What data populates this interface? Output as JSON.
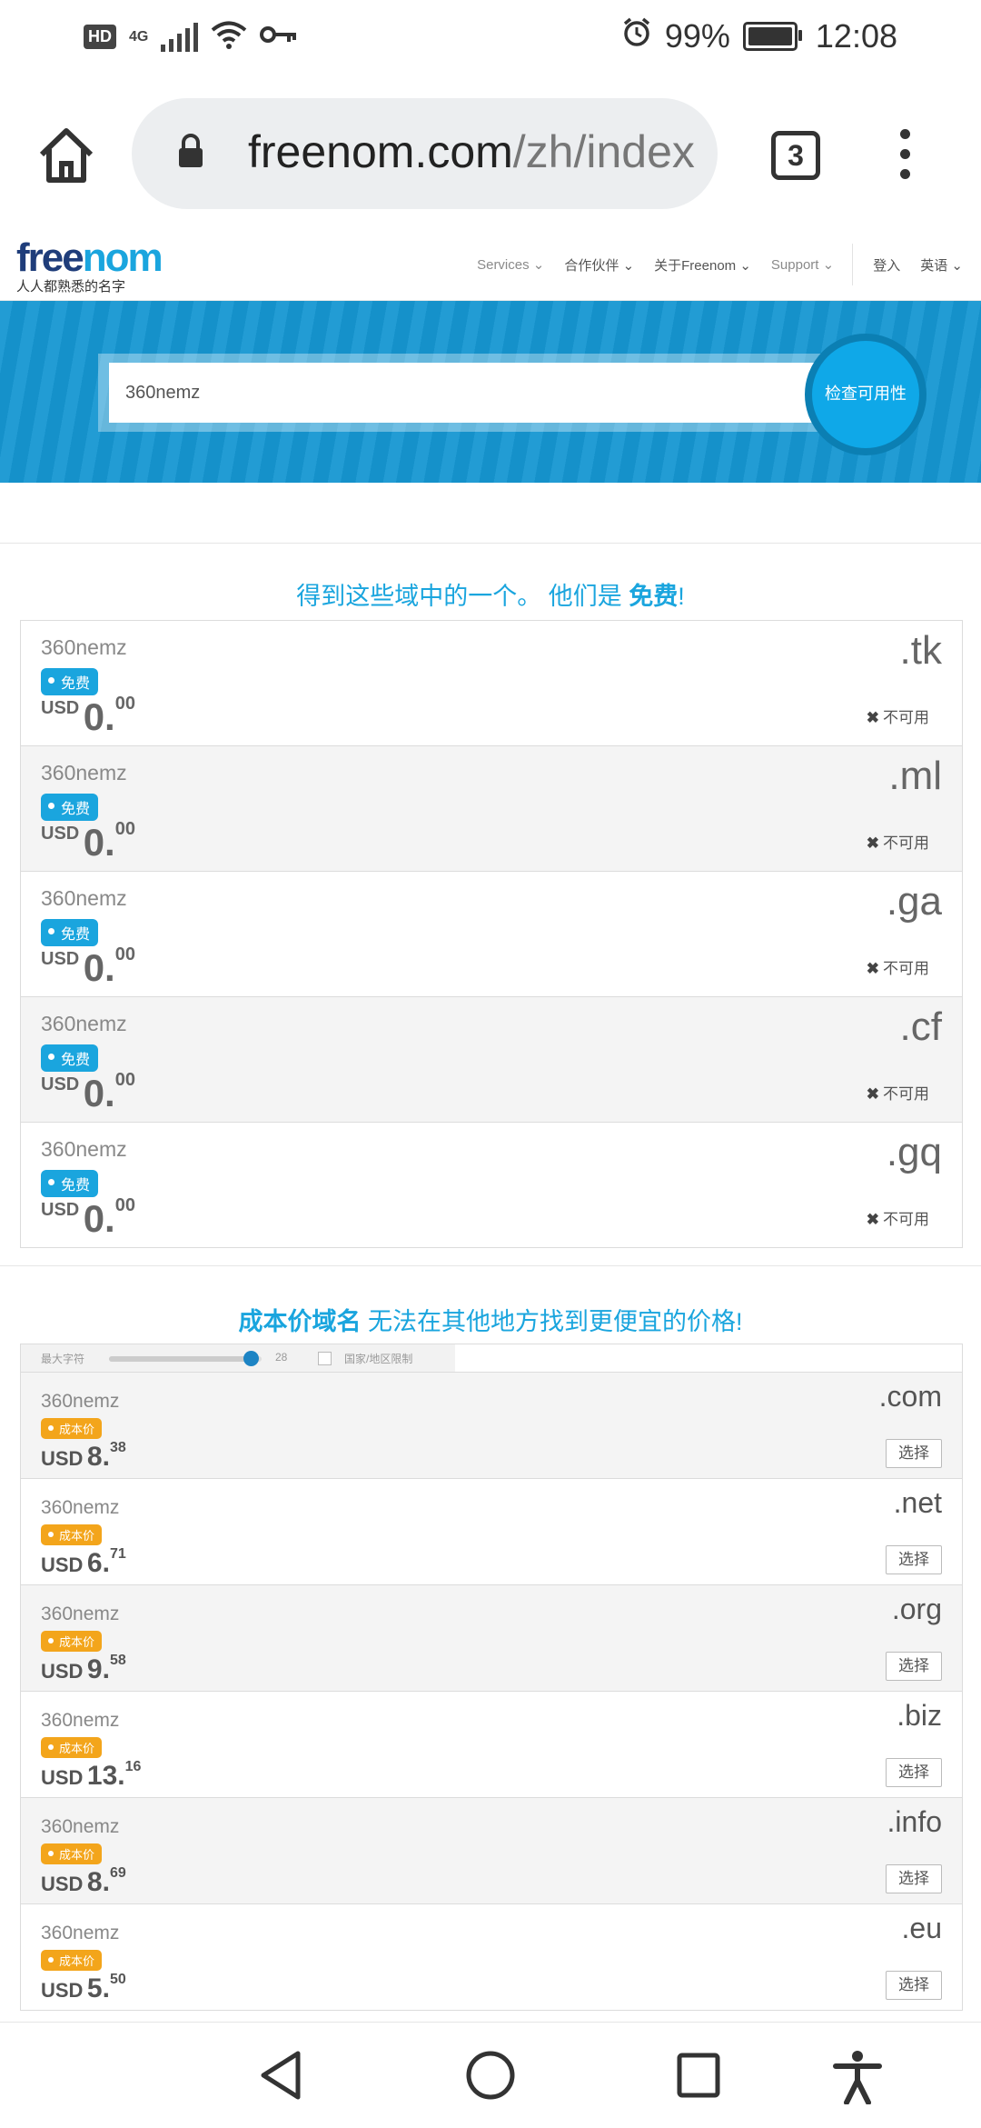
{
  "status_bar": {
    "left_badges": [
      "HD",
      "4G"
    ],
    "battery": "99%",
    "time": "12:08"
  },
  "browser": {
    "url_main": "freenom.com",
    "url_path": "/zh/index",
    "tab_count": "3",
    "icons": [
      "home-icon",
      "lock-icon",
      "tabs-icon",
      "more-vert-icon"
    ]
  },
  "site_nav": {
    "logo_text_dark": "free",
    "logo_text_light": "nom",
    "logo_tagline": "人人都熟悉的名字",
    "items": [
      "Services",
      "合作伙伴",
      "关于Freenom",
      "Support"
    ],
    "login": "登入",
    "language": "英语"
  },
  "search": {
    "value": "360nemz",
    "button": "检查可用性"
  },
  "free_section": {
    "title_prefix": "得到这些域中的一个。 他们是 ",
    "title_bold": "免费",
    "title_suffix": "!",
    "badge": "免费",
    "currency": "USD",
    "price_main": "0.",
    "price_cents": "00",
    "unavailable_label": "不可用",
    "domains": [
      {
        "name": "360nemz",
        "tld": ".tk"
      },
      {
        "name": "360nemz",
        "tld": ".ml"
      },
      {
        "name": "360nemz",
        "tld": ".ga"
      },
      {
        "name": "360nemz",
        "tld": ".cf"
      },
      {
        "name": "360nemz",
        "tld": ".gq"
      }
    ]
  },
  "cost_section": {
    "title_bold": "成本价域名",
    "title_rest": " 无法在其他地方找到更便宜的价格!",
    "filter": {
      "max_chars_label": "最大字符",
      "max_chars_value": "28",
      "slider_fraction": 0.93,
      "country_label": "国家/地区限制"
    },
    "badge": "成本价",
    "currency": "USD",
    "select_label": "选择",
    "domains": [
      {
        "name": "360nemz",
        "tld": ".com",
        "price_main": "8.",
        "price_cents": "38"
      },
      {
        "name": "360nemz",
        "tld": ".net",
        "price_main": "6.",
        "price_cents": "71"
      },
      {
        "name": "360nemz",
        "tld": ".org",
        "price_main": "9.",
        "price_cents": "58"
      },
      {
        "name": "360nemz",
        "tld": ".biz",
        "price_main": "13.",
        "price_cents": "16"
      },
      {
        "name": "360nemz",
        "tld": ".info",
        "price_main": "8.",
        "price_cents": "69"
      },
      {
        "name": "360nemz",
        "tld": ".eu",
        "price_main": "5.",
        "price_cents": "50"
      }
    ]
  },
  "nav_bar": {
    "icons": [
      "back-icon",
      "home-circle-icon",
      "recents-icon",
      "accessibility-icon"
    ]
  }
}
